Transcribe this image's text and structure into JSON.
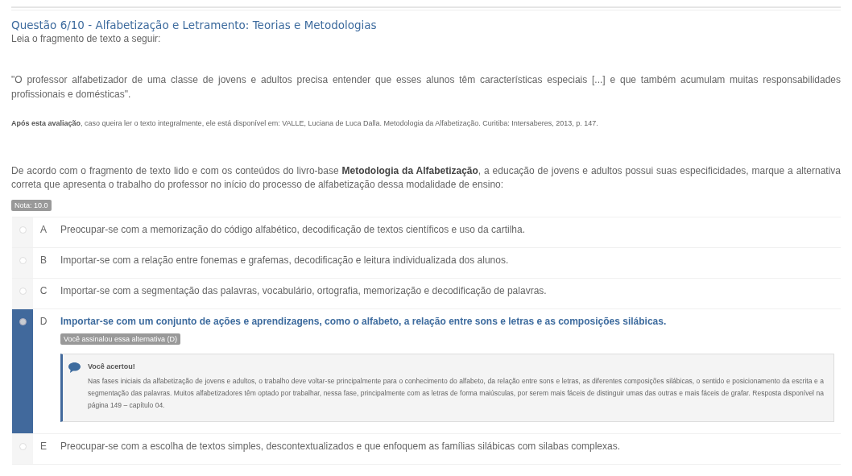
{
  "question": {
    "title": "Questão 6/10 - Alfabetização e Letramento: Teorias e Metodologias",
    "intro": "Leia o fragmento de texto a seguir:",
    "quote": "\"O professor alfabetizador de uma classe de jovens e adultos precisa entender que esses alunos têm características especiais [...] e que também acumulam muitas responsabilidades profissionais e domésticas\".",
    "source": "**Após esta avaliação**, caso queira ler o texto integralmente, ele está disponível em: VALLE, Luciana de Luca Dalla. Metodologia da Alfabetização. Curitiba: Intersaberes, 2013, p. 147.",
    "prompt": "De acordo com o fragmento de texto lido e com os conteúdos do livro-base **Metodologia da Alfabetização**, a educação de jovens e adultos possui suas especificidades, marque a alternativa correta que apresenta o trabalho do professor no início do processo de alfabetização dessa modalidade de ensino:",
    "grade": "Nota: 10.0"
  },
  "options": [
    {
      "letter": "A",
      "text": "Preocupar-se com a memorização do código alfabético, decodificação de textos científicos e uso da cartilha.",
      "selected": false
    },
    {
      "letter": "B",
      "text": "Importar-se  com a relação entre fonemas e grafemas, decodificação e leitura individualizada dos alunos.",
      "selected": false
    },
    {
      "letter": "C",
      "text": "Importar-se com a segmentação das palavras, vocabulário, ortografia, memorização e decodificação de palavras.",
      "selected": false
    },
    {
      "letter": "D",
      "text": "Importar-se com um conjunto de ações e aprendizagens, como o alfabeto, a relação entre sons e letras e as composições silábicas.",
      "selected": true,
      "badge": "Você assinalou essa alternativa (D)",
      "feedback": {
        "title": "Você acertou!",
        "text": "Nas fases iniciais da alfabetização de jovens e adultos, o trabalho deve voltar-se principalmente para o conhecimento do alfabeto, da relação entre sons e letras, as diferentes composições silábicas, o sentido e posicionamento da escrita e a segmentação das palavras. Muitos alfabetizadores têm optado por trabalhar, nessa fase, principalmente com as letras de forma maiúsculas, por serem mais fáceis de distinguir umas das outras e mais fáceis de grafar. Resposta disponível na página 149 – capítulo 04."
      }
    },
    {
      "letter": "E",
      "text": "Preocupar-se com a escolha de textos simples, descontextualizados e que enfoquem as famílias silábicas com silabas complexas.",
      "selected": false
    }
  ]
}
